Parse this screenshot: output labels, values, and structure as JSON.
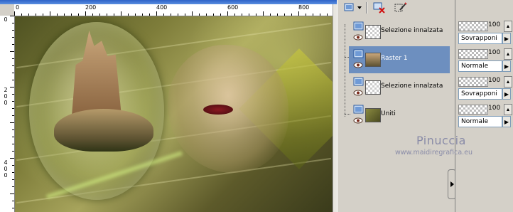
{
  "rulers": {
    "top_labels": [
      "0",
      "200",
      "400",
      "600",
      "800"
    ],
    "left_labels": [
      "0",
      "200",
      "400"
    ]
  },
  "canvas": {
    "content": "photo-composite"
  },
  "layers_toolbar": {
    "icons": [
      "new-layer-icon",
      "dropdown-arrow-icon",
      "delete-layer-icon",
      "edit-mask-icon"
    ]
  },
  "layers": [
    {
      "name": "Selezione innalzata",
      "selected": false,
      "thumb": "transparent",
      "icon": "layer-raster-icon"
    },
    {
      "name": "Raster 1",
      "selected": true,
      "thumb": "castle",
      "icon": "layer-raster-icon"
    },
    {
      "name": "Selezione innalzata",
      "selected": false,
      "thumb": "transparent",
      "icon": "layer-raster-icon"
    },
    {
      "name": "Uniti",
      "selected": false,
      "thumb": "image",
      "icon": "layer-raster-icon"
    }
  ],
  "layer_props": [
    {
      "opacity": "100",
      "blend": "Sovrapponi"
    },
    {
      "opacity": "100",
      "blend": "Normale"
    },
    {
      "opacity": "100",
      "blend": "Sovrapponi"
    },
    {
      "opacity": "100",
      "blend": "Normale"
    }
  ],
  "watermark": {
    "title": "Pinuccia",
    "url": "www.maidiregrafica.eu"
  },
  "colors": {
    "selected_row": "#6d8fbf",
    "panel_bg": "#d4d0c8",
    "watermark": "#8a8ca8"
  }
}
